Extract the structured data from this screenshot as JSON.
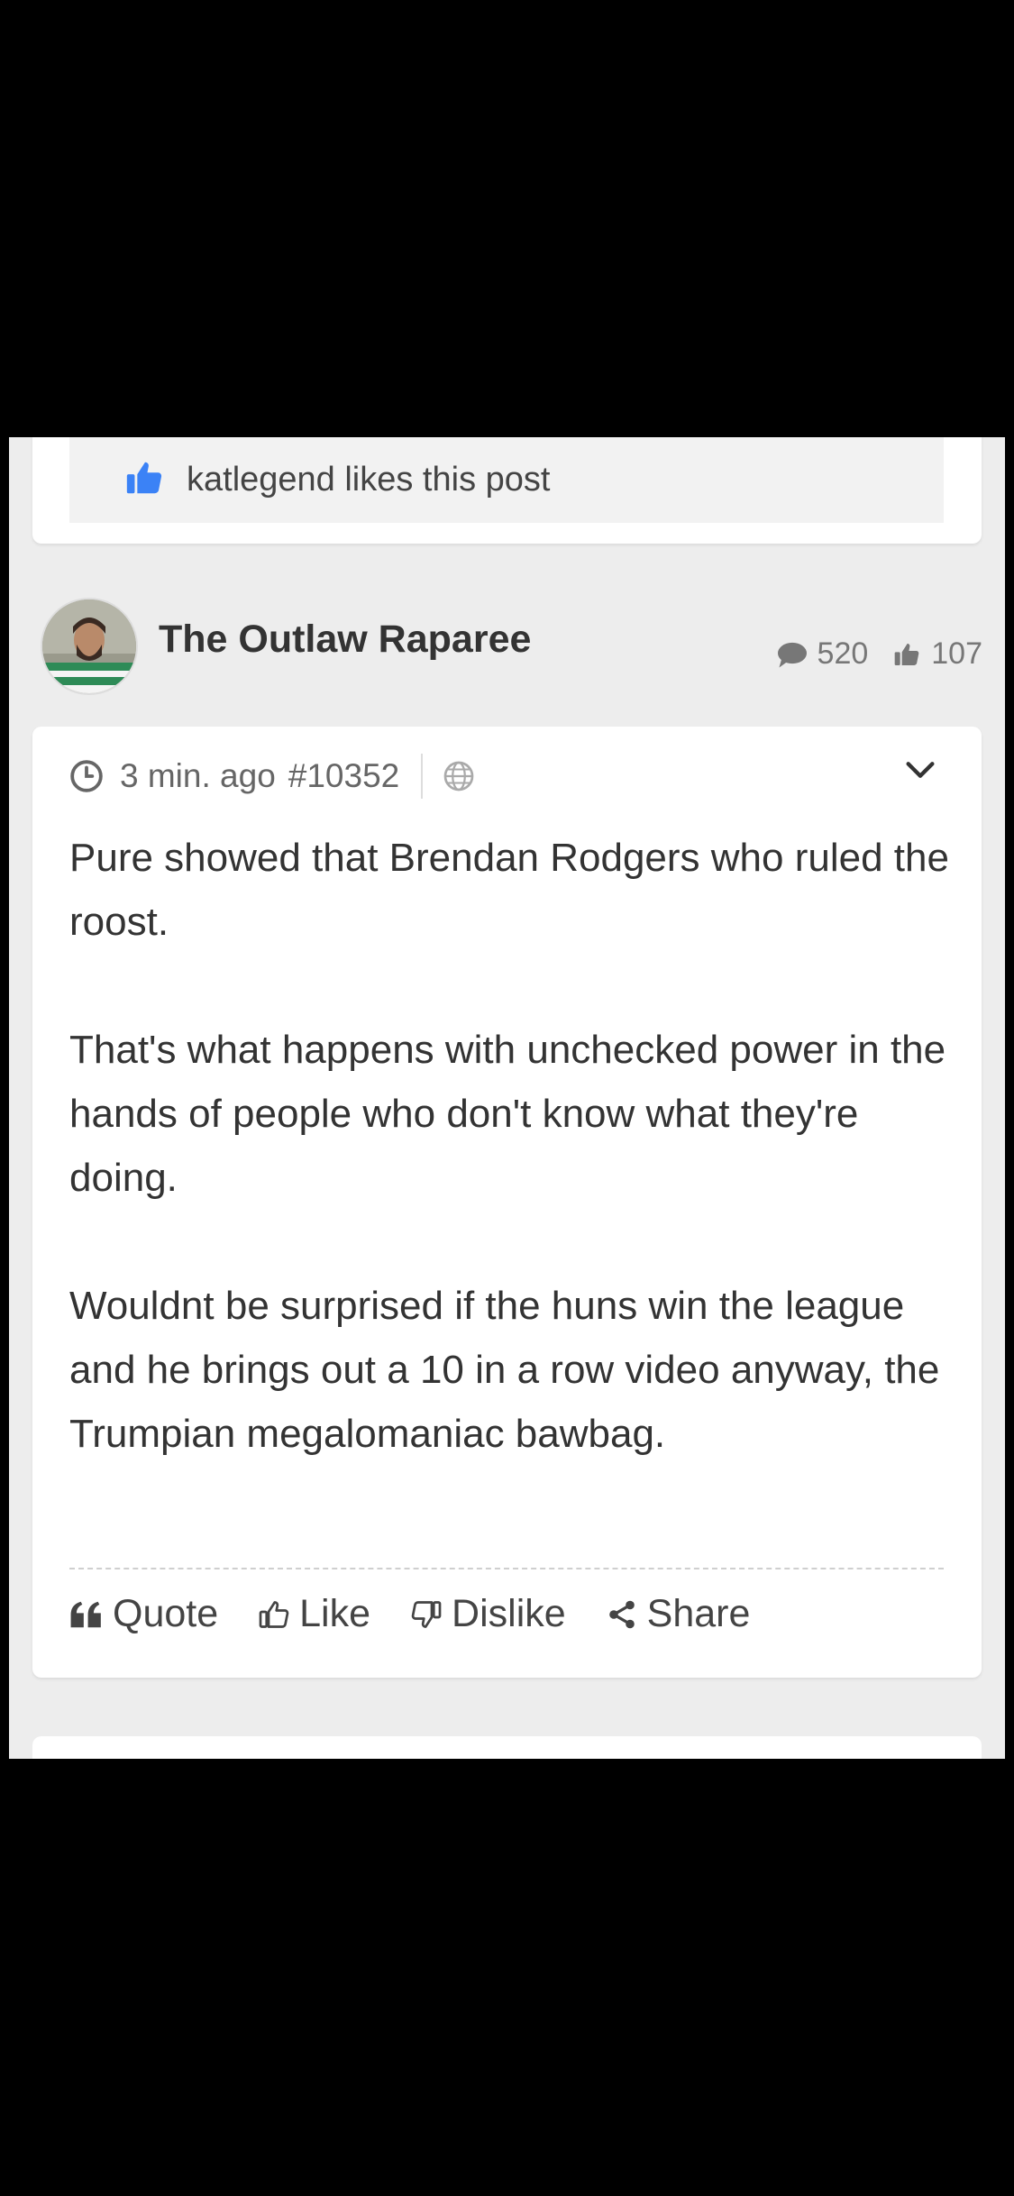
{
  "likes": {
    "icon": "thumbs-up-icon",
    "text": "katlegend likes this post",
    "accent": "#3b82f6"
  },
  "author": {
    "name": "The Outlaw Raparee",
    "comment_count": "520",
    "like_count": "107"
  },
  "post": {
    "time": "3 min. ago",
    "id": "#10352",
    "paragraphs": [
      "Pure showed that Brendan Rodgers who ruled the roost.",
      "That's what happens with unchecked power in the hands of people who don't know what they're doing.",
      "Wouldnt be surprised if the huns win the league and he brings out a 10 in a row video anyway, the Trumpian megalomaniac bawbag."
    ]
  },
  "actions": {
    "quote": "Quote",
    "like": "Like",
    "dislike": "Dislike",
    "share": "Share"
  }
}
